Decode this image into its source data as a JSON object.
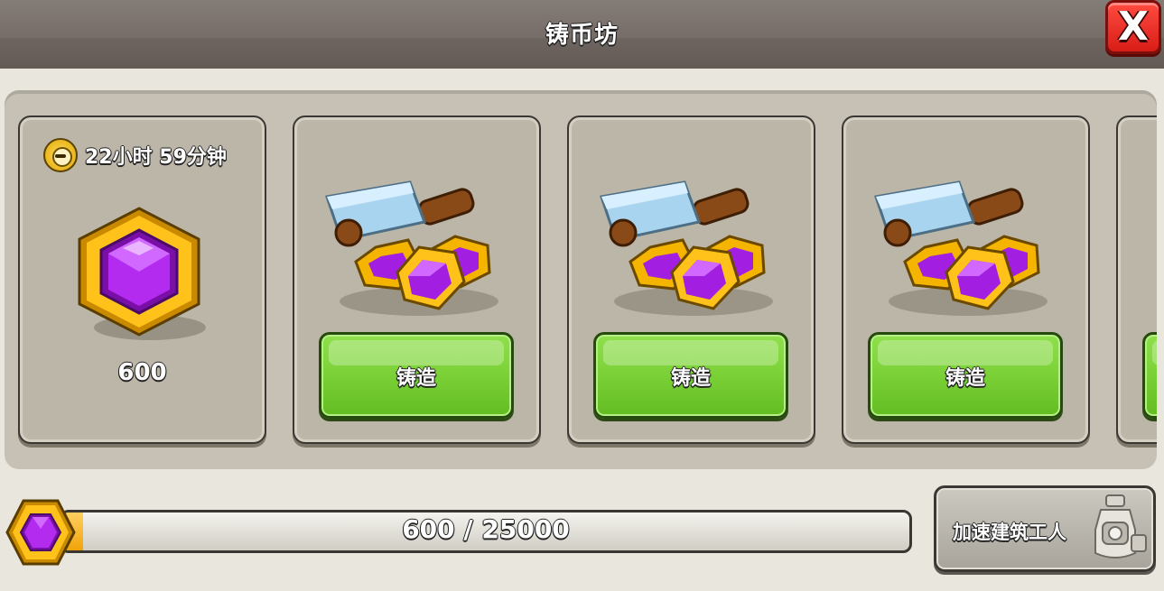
{
  "window": {
    "title": "铸币坊",
    "close_label": "X"
  },
  "storage_card": {
    "timer_text": "22小时 59分钟",
    "amount": "600"
  },
  "forge_cards": [
    {
      "button_label": "铸造"
    },
    {
      "button_label": "铸造"
    },
    {
      "button_label": "铸造"
    }
  ],
  "progress": {
    "text": "600 / 25000",
    "current": 600,
    "max": 25000
  },
  "speed_button": {
    "label": "加速建筑工人"
  },
  "colors": {
    "gem_purple": "#a21ee0",
    "gem_gold": "#f5b400",
    "button_green": "#7fd43b",
    "close_red": "#e0231b"
  },
  "icons": [
    "clock-icon",
    "gem-icon",
    "hammer-gems-icon",
    "builder-potion-icon",
    "close-icon"
  ]
}
